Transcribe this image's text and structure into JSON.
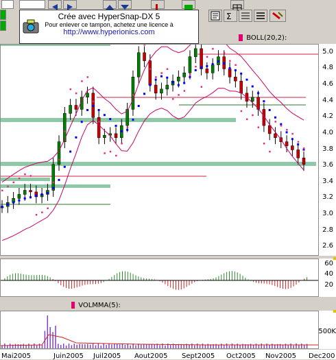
{
  "watermark": {
    "title": "Crée avec HyperSnap-DX 5",
    "subtitle": "Pour enlever ce tampon, achetez une licence à",
    "url": "http://www.hyperionics.com"
  },
  "toolbar": {
    "icons": [
      "arrow-left-icon",
      "arrow-right-icon",
      "up-icon",
      "down-icon",
      "text-icon",
      "sum-icon",
      "lines-icon",
      "tool-icon"
    ]
  },
  "price_panel": {
    "indicator_label": "BOLL(20,2):",
    "y_ticks": [
      "5.0",
      "4.8",
      "4.6",
      "4.4",
      "4.2",
      "4.0",
      "3.8",
      "3.6",
      "3.4",
      "3.2",
      "3.0",
      "2.8",
      "2.6"
    ]
  },
  "oscillator_panel": {
    "y_ticks": [
      "60",
      "40",
      "20"
    ]
  },
  "volume_panel": {
    "indicator_label": "VOLMMA(5):",
    "y_ticks": [
      "500K"
    ]
  },
  "x_axis": {
    "months": [
      "Mai2005",
      "Juin2005",
      "Juil2005",
      "Aout2005",
      "Sept2005",
      "Oct2005",
      "Nov2005",
      "Dec200"
    ]
  },
  "colors": {
    "up_candle": "#008000",
    "down_candle": "#cc0000",
    "ma": "#0000ff",
    "band": "#cc0066",
    "support": "#8fc8a6"
  },
  "chart_data": {
    "type": "line",
    "title": "",
    "xlabel": "",
    "ylabel": "",
    "ylim": [
      2.5,
      5.1
    ],
    "x": [
      "Mai2005",
      "Juin2005",
      "Juil2005",
      "Aout2005",
      "Sept2005",
      "Oct2005",
      "Nov2005"
    ],
    "series": [
      {
        "values": [
          3.2,
          3.3,
          4.05,
          4.85,
          4.75,
          4.55,
          3.75
        ]
      }
    ]
  }
}
